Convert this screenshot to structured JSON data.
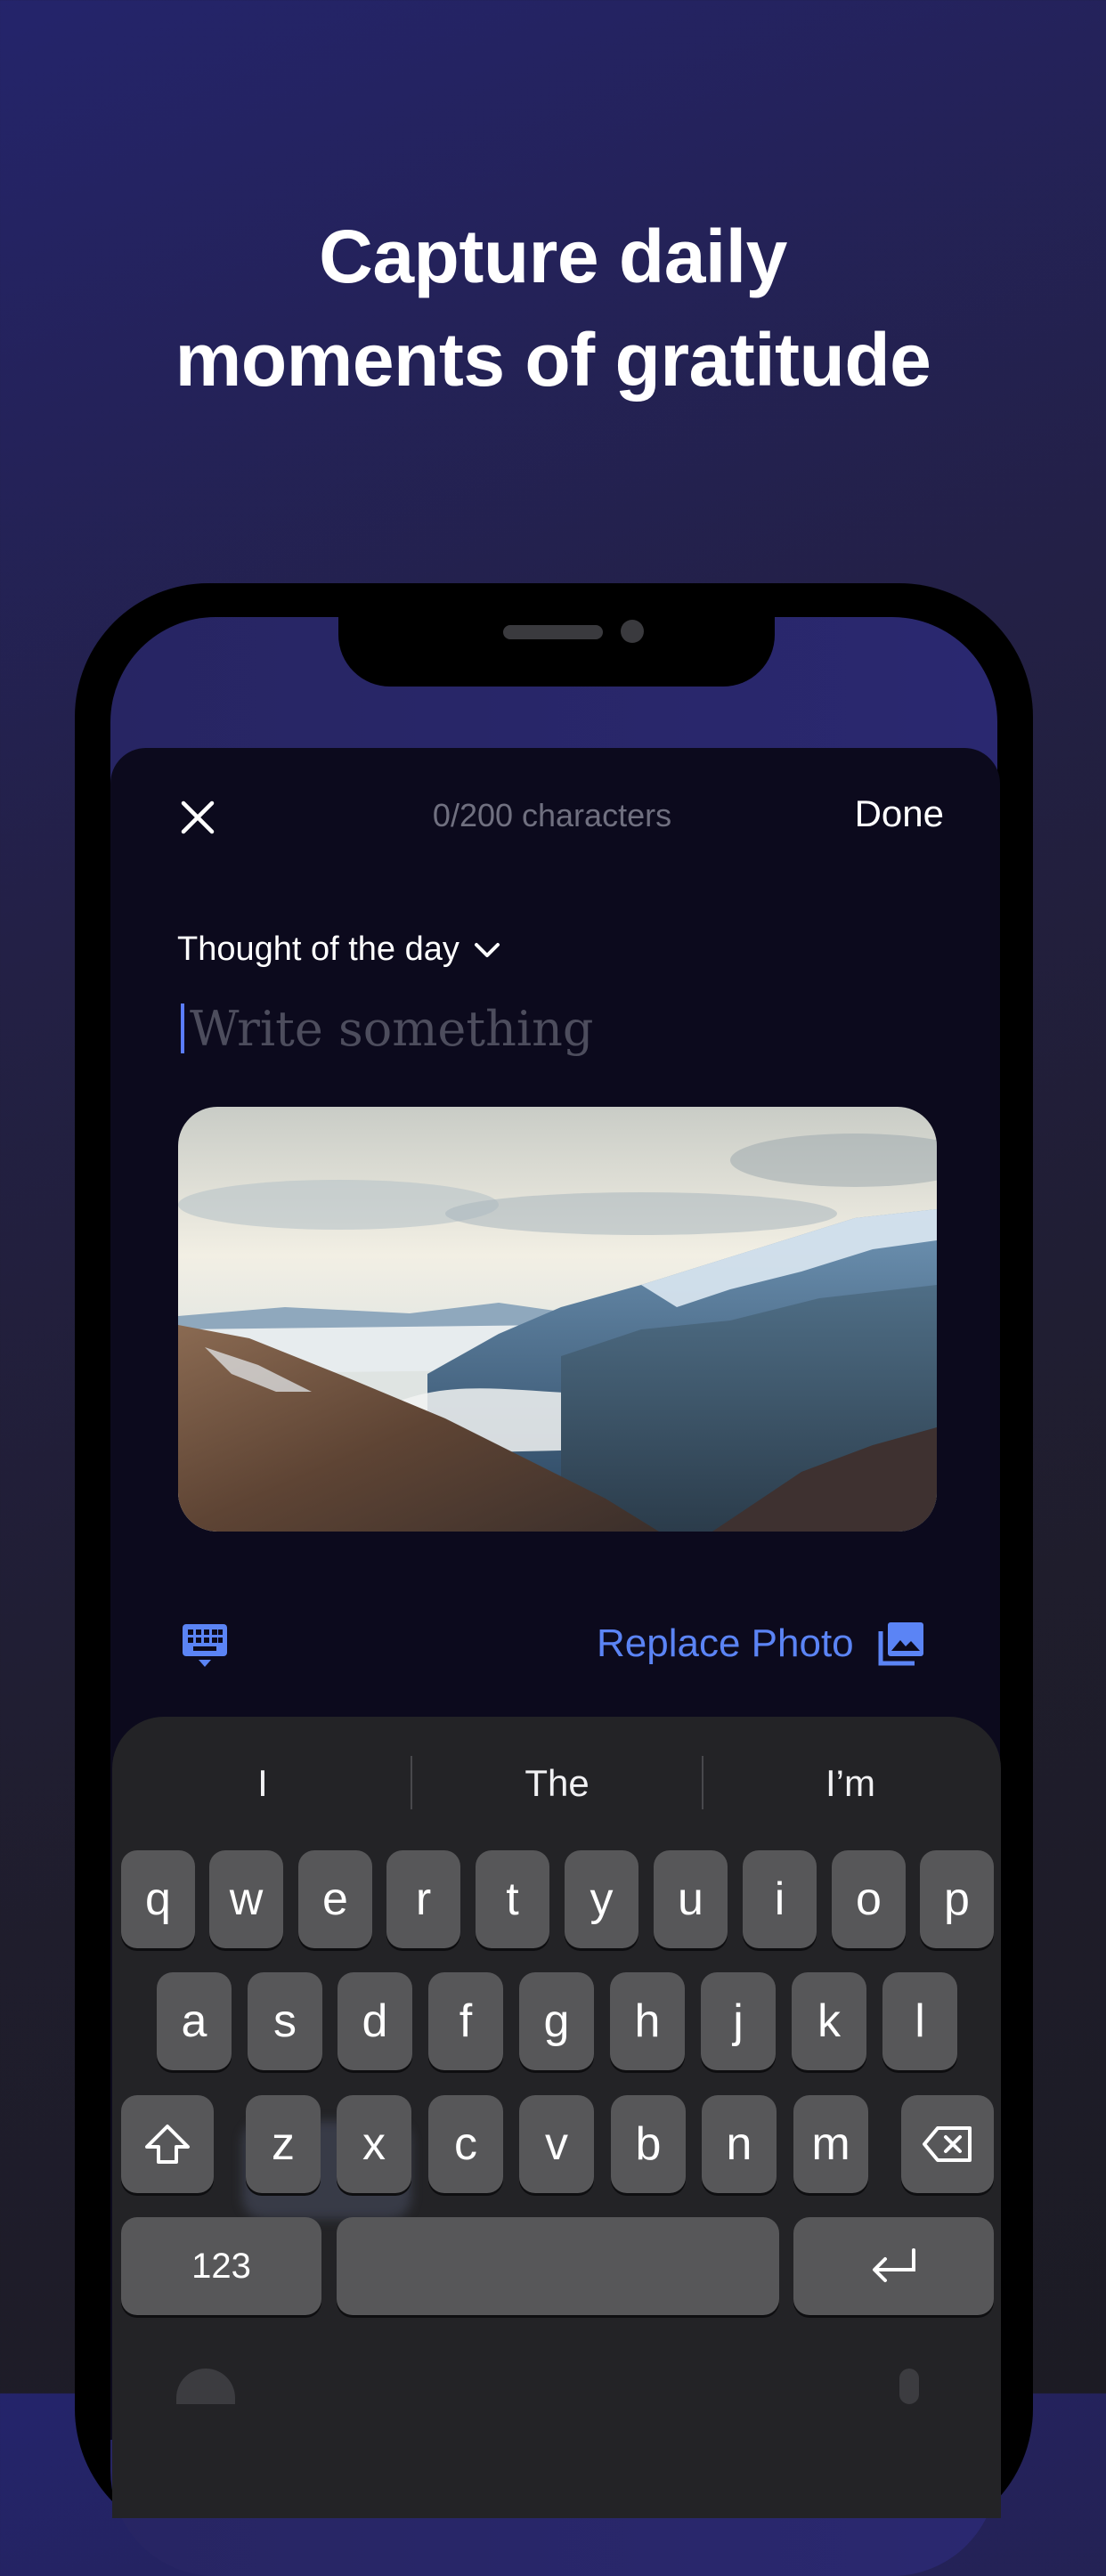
{
  "headline": {
    "line1": "Capture daily",
    "line2": "moments of gratitude"
  },
  "composer": {
    "close_icon": "close-icon",
    "char_count": "0/200 characters",
    "done_label": "Done",
    "prompt_label": "Thought of the day",
    "text_placeholder": "Write something",
    "photo_alt": "Mountain landscape with clouds",
    "keyboard_toggle_icon": "keyboard-icon",
    "replace_photo_label": "Replace Photo",
    "replace_photo_icon": "gallery-icon",
    "accent_color": "#5b84f5"
  },
  "keyboard": {
    "suggestions": [
      "I",
      "The",
      "I’m"
    ],
    "row1": [
      "q",
      "w",
      "e",
      "r",
      "t",
      "y",
      "u",
      "i",
      "o",
      "p"
    ],
    "row2": [
      "a",
      "s",
      "d",
      "f",
      "g",
      "h",
      "j",
      "k",
      "l"
    ],
    "row3": [
      "z",
      "x",
      "c",
      "v",
      "b",
      "n",
      "m"
    ],
    "numbers_label": "123",
    "shift_icon": "shift-icon",
    "backspace_icon": "backspace-icon",
    "return_icon": "return-icon"
  }
}
